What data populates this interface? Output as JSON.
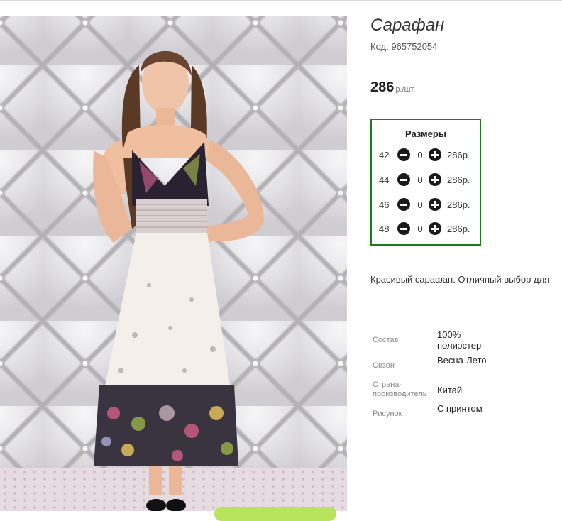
{
  "product": {
    "title": "Сарафан",
    "code": "Код: 965752054",
    "price": "286",
    "price_unit": "р./шт.",
    "description": "Красивый сарафан. Отличный выбор для"
  },
  "sizes": {
    "heading": "Размеры",
    "items": [
      {
        "size": "42",
        "qty": "0",
        "price": "286р."
      },
      {
        "size": "44",
        "qty": "0",
        "price": "286р."
      },
      {
        "size": "46",
        "qty": "0",
        "price": "286р."
      },
      {
        "size": "48",
        "qty": "0",
        "price": "286р."
      }
    ]
  },
  "attributes": [
    {
      "key": "Состав",
      "value": "100% полиэстер"
    },
    {
      "key": "Сезон",
      "value": "Весна-Лето"
    },
    {
      "key": "Страна-производитель",
      "value": "Китай"
    },
    {
      "key": "Рисунок",
      "value": "С принтом"
    }
  ],
  "colors": {
    "sizes_border": "#1a7d1a",
    "add_button": "#b8e35c"
  },
  "icons": {
    "decrease": "minus-circle-icon",
    "increase": "plus-circle-icon"
  }
}
